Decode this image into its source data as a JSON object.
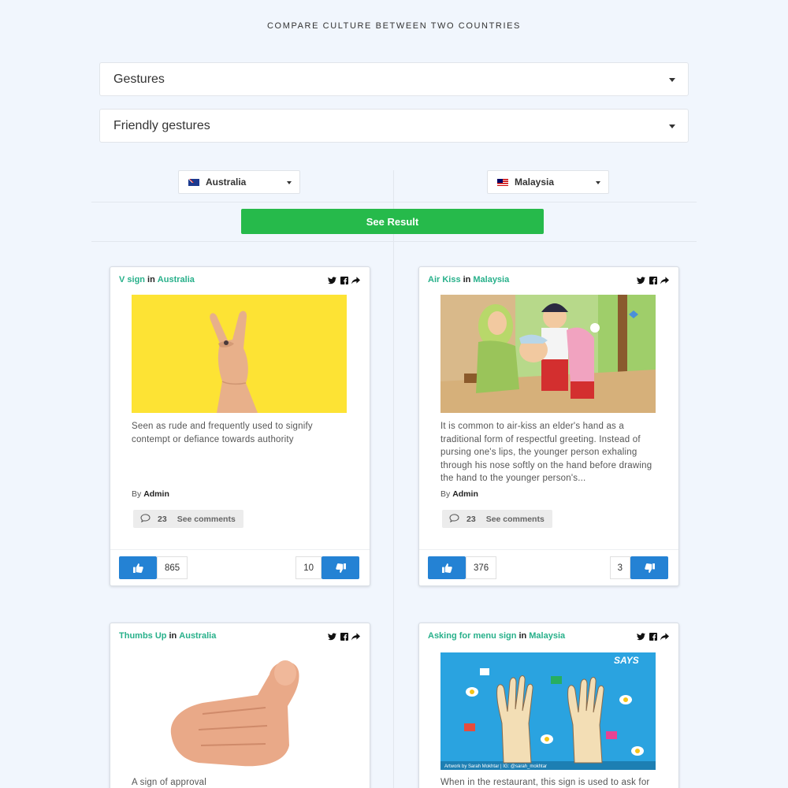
{
  "page_title": "COMPARE CULTURE BETWEEN TWO COUNTRIES",
  "category_select": {
    "value": "Gestures"
  },
  "subcategory_select": {
    "value": "Friendly gestures"
  },
  "country_left": {
    "name": "Australia",
    "flag": "australia-flag-icon"
  },
  "country_right": {
    "name": "Malaysia",
    "flag": "malaysia-flag-icon"
  },
  "see_result_label": "See Result",
  "colors": {
    "background": "#f1f6fd",
    "accent_green": "#26ba4b",
    "link_green": "#27b08a",
    "vote_blue": "#2482d4"
  },
  "cards": [
    {
      "title": "V sign",
      "in": "in",
      "country": "Australia",
      "description": "Seen as rude and frequently used to signify contempt or defiance towards authority",
      "by": "By",
      "author": "Admin",
      "comments_count": "23",
      "comments_label": "See comments",
      "likes": "865",
      "dislikes": "10"
    },
    {
      "title": "Air Kiss",
      "in": "in",
      "country": "Malaysia",
      "description": "It is common to air-kiss an elder's hand as a traditional form of respectful greeting. Instead of pursing one's lips, the younger person exhaling through his nose softly on the hand before drawing the hand to the younger person's...",
      "by": "By",
      "author": "Admin",
      "comments_count": "23",
      "comments_label": "See comments",
      "likes": "376",
      "dislikes": "3"
    },
    {
      "title": "Thumbs Up",
      "in": "in",
      "country": "Australia",
      "description": "A sign of approval"
    },
    {
      "title": "Asking for menu sign",
      "in": "in",
      "country": "Malaysia",
      "description": "When in the restaurant, this sign is used to ask for",
      "image_text": {
        "brand": "SAYS",
        "credit": "Artwork by Sarah Mokhtar | IG: @sarah_mokhtar"
      }
    }
  ]
}
